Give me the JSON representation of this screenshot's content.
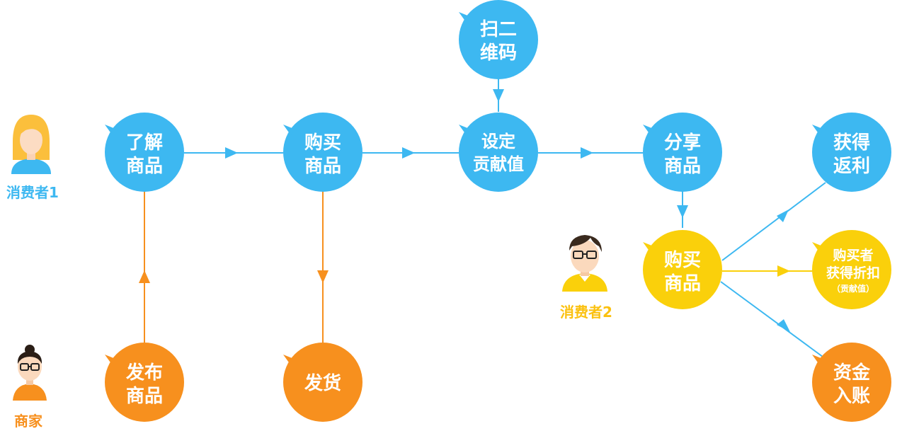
{
  "colors": {
    "blue": "#3DB8F1",
    "orange": "#F7901E",
    "yellow": "#FAD00B",
    "consumer2_label": "#FBC10F",
    "merchant_label": "#F7901E",
    "consumer1_label": "#3DB8F1"
  },
  "actors": {
    "consumer1": {
      "label": "消费者1"
    },
    "consumer2": {
      "label": "消费者2"
    },
    "merchant": {
      "label": "商家"
    }
  },
  "nodes": {
    "learn_product": {
      "line1": "了解",
      "line2": "商品"
    },
    "buy_product": {
      "line1": "购买",
      "line2": "商品"
    },
    "set_contribution": {
      "line1": "设定",
      "line2": "贡献值"
    },
    "scan_qr": {
      "line1": "扫二",
      "line2": "维码"
    },
    "share_product": {
      "line1": "分享",
      "line2": "商品"
    },
    "get_rebate": {
      "line1": "获得",
      "line2": "返利"
    },
    "buy_product_2": {
      "line1": "购买",
      "line2": "商品"
    },
    "buyer_discount": {
      "line1": "购买者",
      "line2": "获得折扣",
      "line3": "（贡献值）"
    },
    "funds_received": {
      "line1": "资金",
      "line2": "入账"
    },
    "publish_product": {
      "line1": "发布",
      "line2": "商品"
    },
    "ship": {
      "line1": "发货"
    }
  }
}
